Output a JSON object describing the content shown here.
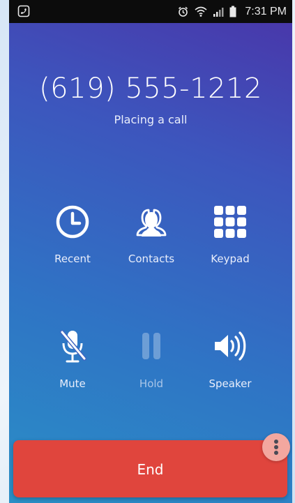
{
  "status_bar": {
    "time": "7:31 PM",
    "icons": [
      "phone-call-icon",
      "alarm-icon",
      "wifi-icon",
      "signal-icon",
      "battery-icon"
    ]
  },
  "call": {
    "number": "(619) 555-1212",
    "status": "Placing a call"
  },
  "actions": {
    "recent": {
      "label": "Recent",
      "icon": "clock-icon"
    },
    "contacts": {
      "label": "Contacts",
      "icon": "contacts-icon"
    },
    "keypad": {
      "label": "Keypad",
      "icon": "keypad-icon"
    },
    "mute": {
      "label": "Mute",
      "icon": "microphone-muted-icon"
    },
    "hold": {
      "label": "Hold",
      "icon": "pause-icon",
      "enabled": false
    },
    "speaker": {
      "label": "Speaker",
      "icon": "speaker-icon"
    }
  },
  "end_button": {
    "label": "End"
  },
  "more_button": {
    "icon": "more-vertical-icon"
  },
  "colors": {
    "gradient_top": "#4a34a8",
    "gradient_bottom": "#2a8fc6",
    "end_red": "#e0453d",
    "more_pink": "#f3a79f",
    "status_bar": "#0c0c0c"
  }
}
